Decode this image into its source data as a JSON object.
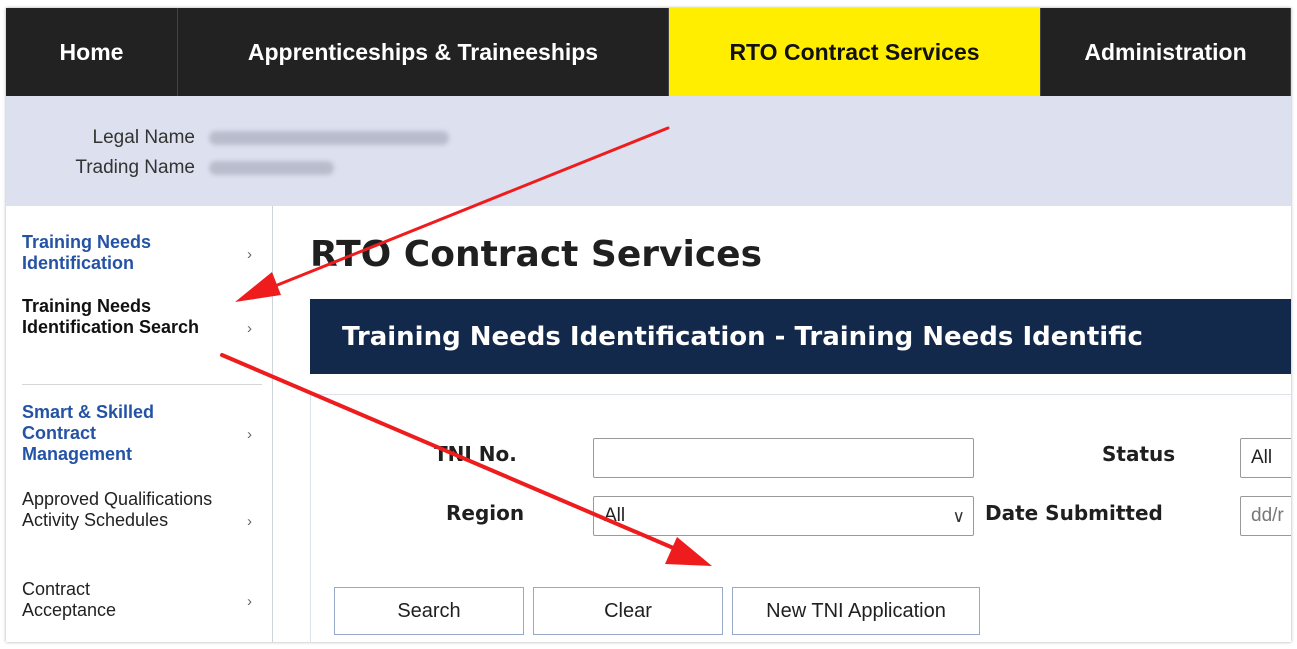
{
  "nav": {
    "tabs": [
      {
        "label": "Home"
      },
      {
        "label": "Apprenticeships & Traineeships"
      },
      {
        "label": "RTO Contract Services"
      },
      {
        "label": "Administration"
      }
    ],
    "active_color": "#ffee00"
  },
  "org": {
    "legal_name_label": "Legal Name",
    "trading_name_label": "Trading Name"
  },
  "sidebar": {
    "items": [
      {
        "label": "Training Needs Identification",
        "chevron": "›"
      },
      {
        "label": "Training Needs Identification Search",
        "chevron": "›"
      },
      {
        "label": "Smart & Skilled Contract Management",
        "chevron": "›"
      },
      {
        "label": "Approved Qualifications Activity Schedules",
        "chevron": "›"
      },
      {
        "label": "Contract Acceptance",
        "chevron": "›"
      }
    ]
  },
  "main": {
    "title": "RTO Contract Services",
    "banner": "Training Needs Identification - Training Needs Identific",
    "form": {
      "tni_label": "TNI No.",
      "tni_value": "",
      "status_label": "Status",
      "status_value": "All",
      "region_label": "Region",
      "region_value": "All",
      "date_label": "Date Submitted",
      "date_placeholder": "dd/r"
    },
    "buttons": {
      "search": "Search",
      "clear": "Clear",
      "new_tni": "New TNI Application"
    }
  },
  "annotation_color": "#ee1c1c"
}
